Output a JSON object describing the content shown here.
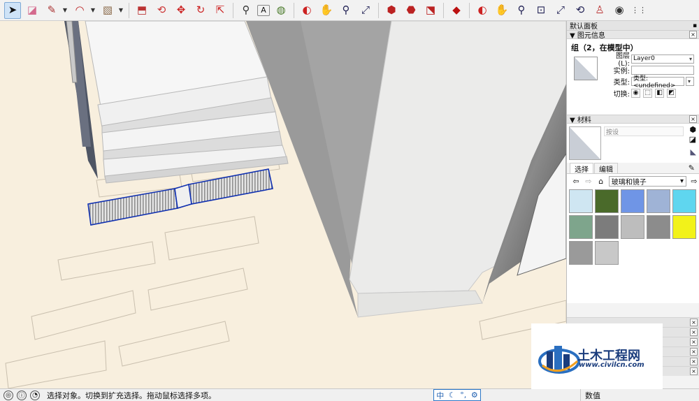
{
  "toolbar": {
    "tools": [
      {
        "name": "select",
        "glyph": "➤"
      },
      {
        "name": "eraser",
        "glyph": "◪"
      },
      {
        "name": "pencil",
        "glyph": "✎"
      },
      {
        "name": "arc",
        "glyph": "◠"
      },
      {
        "name": "rectangle",
        "glyph": "▧"
      },
      {
        "name": "push-pull",
        "glyph": "⬒"
      },
      {
        "name": "offset",
        "glyph": "⟲"
      },
      {
        "name": "move",
        "glyph": "✥"
      },
      {
        "name": "rotate",
        "glyph": "↻"
      },
      {
        "name": "scale",
        "glyph": "⇱"
      },
      {
        "name": "tape-measure",
        "glyph": "⚲"
      },
      {
        "name": "text",
        "glyph": "A"
      },
      {
        "name": "paint-bucket",
        "glyph": "◍"
      },
      {
        "name": "orbit",
        "glyph": "◐"
      },
      {
        "name": "pan",
        "glyph": "✋"
      },
      {
        "name": "zoom",
        "glyph": "⚲"
      },
      {
        "name": "zoom-extents",
        "glyph": "⤢"
      },
      {
        "name": "3d-warehouse",
        "glyph": "⬢"
      },
      {
        "name": "extension-warehouse",
        "glyph": "⬣"
      },
      {
        "name": "share-model",
        "glyph": "⬔"
      },
      {
        "name": "ruby",
        "glyph": "◆"
      },
      {
        "name": "orbit-2",
        "glyph": "◐"
      },
      {
        "name": "pan-2",
        "glyph": "✋"
      },
      {
        "name": "zoom-2",
        "glyph": "⚲"
      },
      {
        "name": "zoom-window",
        "glyph": "⊡"
      },
      {
        "name": "zoom-extents-2",
        "glyph": "⤢"
      },
      {
        "name": "previous-view",
        "glyph": "⟲"
      },
      {
        "name": "position-camera",
        "glyph": "♙"
      },
      {
        "name": "look-around",
        "glyph": "◉"
      },
      {
        "name": "walk",
        "glyph": "⋮⋮"
      }
    ]
  },
  "tray": {
    "title": "默认面板",
    "pin_glyph": "📌",
    "entity_info": {
      "header": "图元信息",
      "title": "组（2，在模型中）",
      "layer_label": "图层(L):",
      "layer_value": "Layer0",
      "instance_label": "实例:",
      "instance_value": "",
      "type_label": "类型:",
      "type_value": "类型: <undefined>",
      "toggle_label": "切换:",
      "toggle_icons": [
        "◉",
        "⬚",
        "◧",
        "◩"
      ]
    },
    "materials": {
      "header": "材料",
      "name_placeholder": "按设",
      "tab_select": "选择",
      "tab_edit": "编辑",
      "library_value": "玻璃和镜子",
      "swatch_colors": [
        "#cfe6f2",
        "#4a6a2a",
        "#6f95e6",
        "#9fb3d6",
        "#5fd6ef",
        "#7ea58c",
        "#7c7c7c",
        "#bdbdbd",
        "#8c8c8c",
        "#f2f21a",
        "#9a9a9a",
        "#c8c8c8"
      ]
    }
  },
  "statusbar": {
    "message": "选择对象。切换到扩充选择。拖动鼠标选择多项。",
    "ime_items": [
      "中",
      "☾",
      "°,",
      "⚙"
    ],
    "measure_label": "数值"
  },
  "watermark": {
    "title": "土木工程网",
    "url": "www.civilcn.com"
  }
}
